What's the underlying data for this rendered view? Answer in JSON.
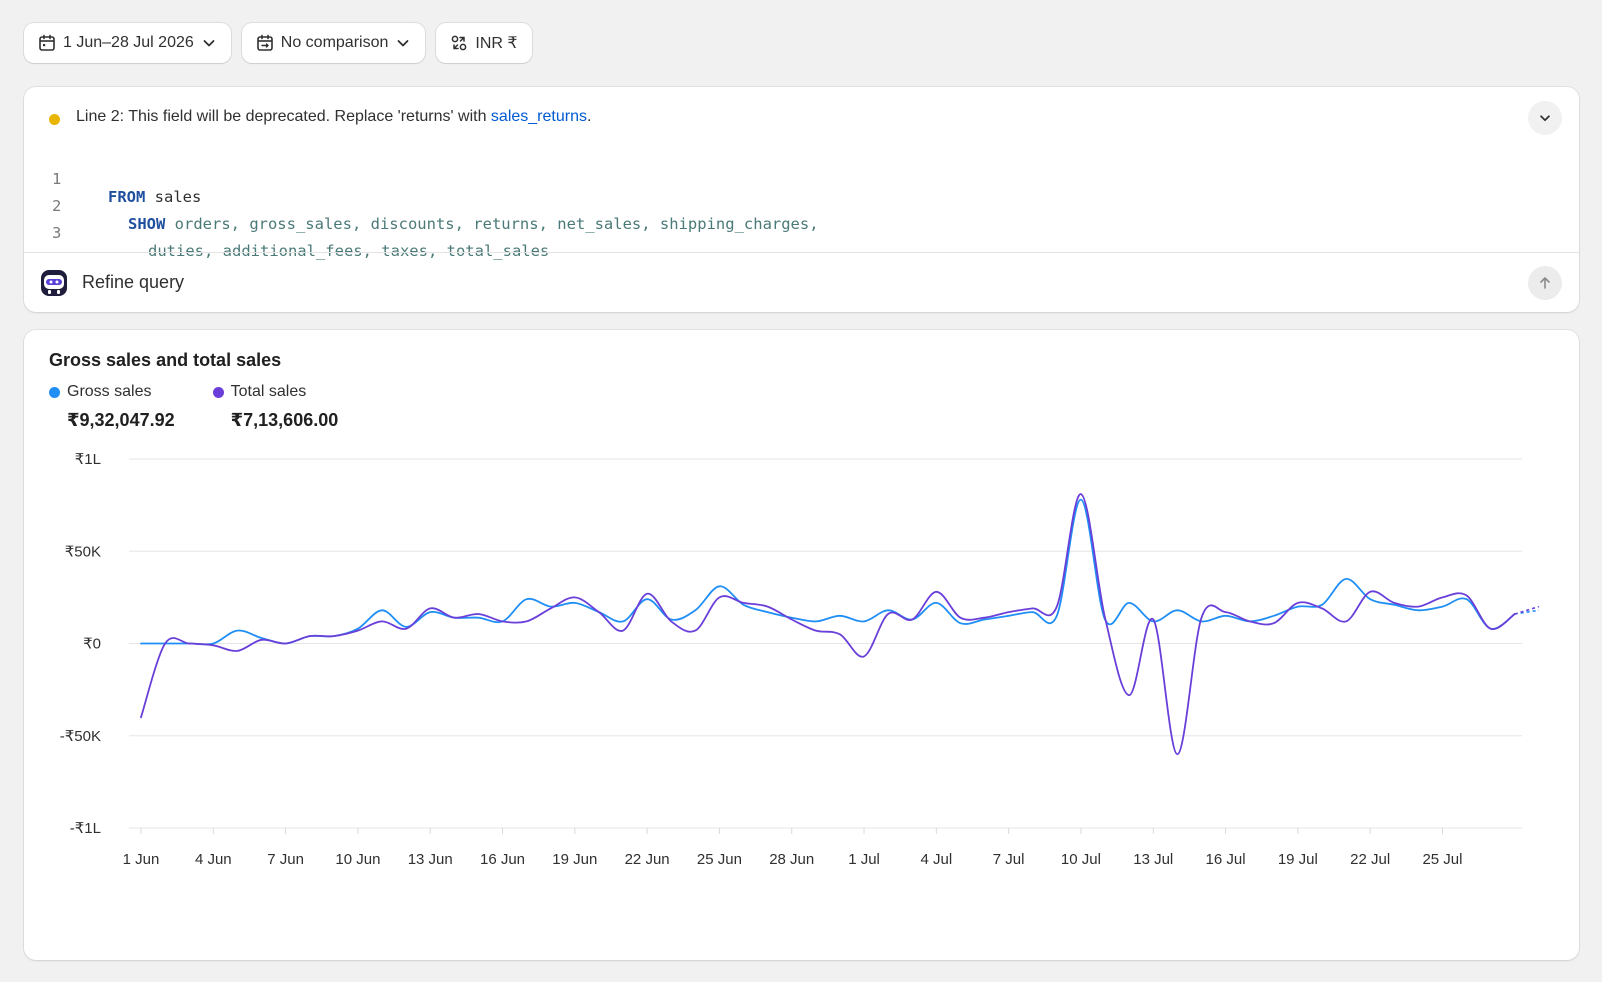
{
  "toolbar": {
    "date_range": "1 Jun–28 Jul 2026",
    "comparison": "No comparison",
    "currency": "INR ₹"
  },
  "query_editor": {
    "warning": {
      "prefix": "Line 2: This field will be deprecated. Replace 'returns' with ",
      "link": "sales_returns",
      "suffix": "."
    },
    "lines": [
      {
        "number": "1",
        "keyword": "FROM",
        "rest": " sales"
      },
      {
        "number": "2",
        "keyword": "SHOW",
        "rest": " orders, gross_sales, discounts, returns, net_sales, shipping_charges,"
      },
      {
        "number": "3",
        "keyword": "",
        "rest": "duties, additional_fees, taxes, total_sales"
      }
    ],
    "refine_placeholder": "Refine query"
  },
  "chart": {
    "title": "Gross sales and total sales",
    "legend": [
      {
        "name": "Gross sales",
        "total": "₹9,32,047.92",
        "color": "#1f8ef5"
      },
      {
        "name": "Total sales",
        "total": "₹7,13,606.00",
        "color": "#6a3fd9"
      }
    ]
  },
  "chart_data": {
    "type": "line",
    "title": "Gross sales and total sales",
    "xlabel": "",
    "ylabel": "",
    "y_tick_labels": [
      "₹1L",
      "₹50K",
      "₹0",
      "-₹50K",
      "-₹1L"
    ],
    "y_ticks": [
      100000,
      50000,
      0,
      -50000,
      -100000
    ],
    "ylim": [
      -100000,
      100000
    ],
    "x_tick_labels": [
      "1 Jun",
      "4 Jun",
      "7 Jun",
      "10 Jun",
      "13 Jun",
      "16 Jun",
      "19 Jun",
      "22 Jun",
      "25 Jun",
      "28 Jun",
      "1 Jul",
      "4 Jul",
      "7 Jul",
      "10 Jul",
      "13 Jul",
      "16 Jul",
      "19 Jul",
      "22 Jul",
      "25 Jul"
    ],
    "x_tick_index": [
      0,
      3,
      6,
      9,
      12,
      15,
      18,
      21,
      24,
      27,
      30,
      33,
      36,
      39,
      42,
      45,
      48,
      51,
      54
    ],
    "x_count": 58,
    "grid": true,
    "legend_position": "top-left",
    "series": [
      {
        "name": "Gross sales",
        "color": "#1f8ef5",
        "values": [
          0,
          0,
          0,
          0,
          7000,
          3000,
          0,
          4000,
          4000,
          8000,
          18000,
          9000,
          17000,
          14000,
          14000,
          12000,
          24000,
          20000,
          22000,
          17000,
          12000,
          24000,
          13000,
          18000,
          31000,
          21000,
          17000,
          14000,
          12000,
          15000,
          12000,
          18000,
          13000,
          22000,
          11000,
          13000,
          15000,
          17000,
          15000,
          78000,
          13000,
          22000,
          12000,
          18000,
          12000,
          15000,
          12000,
          15000,
          20000,
          21000,
          35000,
          24000,
          21000,
          18000,
          20000,
          24000,
          8000,
          16000,
          18000
        ]
      },
      {
        "name": "Total sales",
        "color": "#6a3fd9",
        "values": [
          -40000,
          0,
          0,
          -1000,
          -4000,
          2000,
          0,
          4000,
          4000,
          7000,
          12000,
          8000,
          19000,
          14000,
          16000,
          12000,
          12000,
          19000,
          25000,
          17000,
          7000,
          27000,
          12000,
          7000,
          25000,
          22000,
          20000,
          13000,
          7000,
          5000,
          -7000,
          16000,
          13000,
          28000,
          14000,
          14000,
          17000,
          19000,
          20000,
          81000,
          14000,
          -28000,
          13000,
          -60000,
          14000,
          17000,
          12000,
          11000,
          22000,
          19000,
          12000,
          28000,
          22000,
          20000,
          25000,
          26000,
          8000,
          16000,
          20000
        ]
      }
    ]
  }
}
